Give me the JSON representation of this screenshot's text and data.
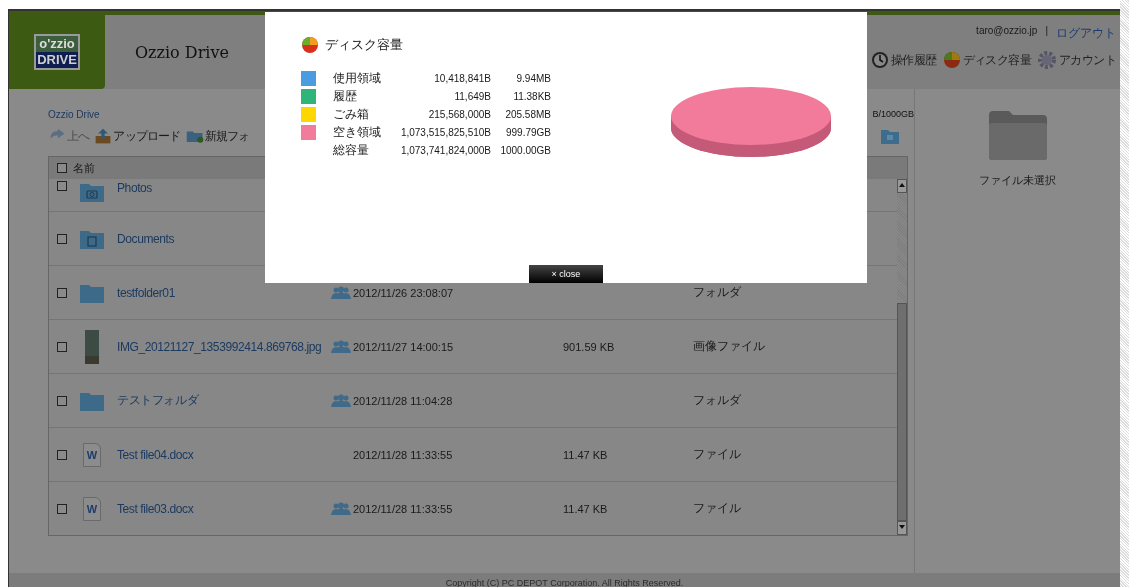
{
  "header": {
    "logo_top": "o'zzio",
    "logo_bottom": "DRIVE",
    "title": "Ozzio Drive",
    "user_email": "taro@ozzio.jp",
    "separator": "|",
    "logout": "ログアウト",
    "nav": [
      {
        "kind": "history",
        "label": "操作履歴"
      },
      {
        "kind": "disk",
        "label": "ディスク容量"
      },
      {
        "kind": "account",
        "label": "アカウント"
      }
    ]
  },
  "breadcrumb": "Ozzio Drive",
  "toolbar": [
    {
      "kind": "up",
      "label": "上へ",
      "disabled": true
    },
    {
      "kind": "upload",
      "label": "アップロード",
      "disabled": false
    },
    {
      "kind": "new-folder",
      "label": "新規フォ",
      "disabled": false
    }
  ],
  "quota": "B/1000GB",
  "table": {
    "header_label": "名前",
    "header_checked": false,
    "rows": [
      {
        "kind": "photos-folder",
        "checked": false,
        "name": "Photos"
      },
      {
        "kind": "documents-folder",
        "checked": false,
        "name": "Documents"
      },
      {
        "kind": "folder",
        "checked": false,
        "name": "testfolder01",
        "shared": true,
        "date": "2012/11/26 23:08:07",
        "type": "フォルダ"
      },
      {
        "kind": "image",
        "checked": false,
        "name": "IMG_20121127_1353992414.869768.jpg",
        "shared": true,
        "date": "2012/11/27 14:00:15",
        "size": "901.59 KB",
        "type": "画像ファイル"
      },
      {
        "kind": "folder",
        "checked": false,
        "name": "テストフォルダ",
        "shared": true,
        "date": "2012/11/28 11:04:28",
        "type": "フォルダ"
      },
      {
        "kind": "word",
        "checked": false,
        "icon_letter": "W",
        "name": "Test file04.docx",
        "shared": false,
        "date": "2012/11/28 11:33:55",
        "size": "11.47 KB",
        "type": "ファイル"
      },
      {
        "kind": "word",
        "checked": false,
        "icon_letter": "W",
        "name": "Test file03.docx",
        "shared": true,
        "date": "2012/11/28 11:33:55",
        "size": "11.47 KB",
        "type": "ファイル"
      }
    ]
  },
  "preview": {
    "label": "ファイル未選択"
  },
  "footer": "Copyright (C) PC DEPOT Corporation. All Rights Reserved.",
  "modal": {
    "title": "ディスク容量",
    "rows": [
      {
        "label": "使用領域",
        "bytes": "10,418,841B",
        "size": "9.94MB",
        "color": "#4a9be0"
      },
      {
        "label": "履歴",
        "bytes": "11,649B",
        "size": "11.38KB",
        "color": "#2fb57a"
      },
      {
        "label": "ごみ箱",
        "bytes": "215,568,000B",
        "size": "205.58MB",
        "color": "#ffd700"
      },
      {
        "label": "空き領域",
        "bytes": "1,073,515,825,510B",
        "size": "999.79GB",
        "color": "#f27a9a"
      },
      {
        "label": "総容量",
        "bytes": "1,073,741,824,000B",
        "size": "1000.00GB"
      }
    ],
    "close": "× close"
  }
}
